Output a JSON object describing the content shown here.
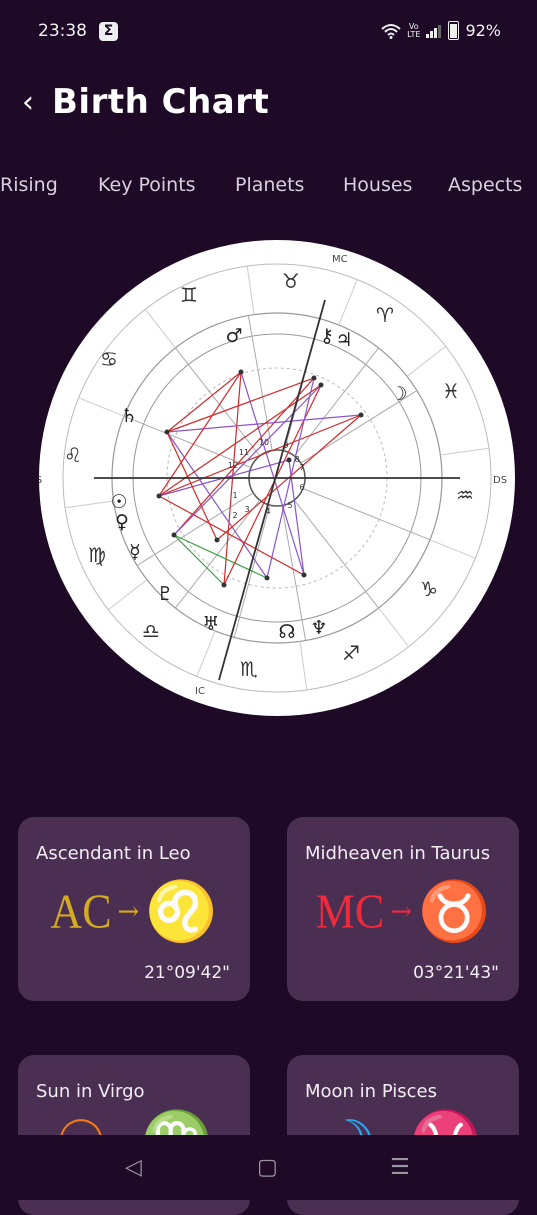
{
  "status_bar": {
    "time": "23:38",
    "app_icon": "Σ",
    "volte": "Vo\nLTE",
    "battery": "92%"
  },
  "header": {
    "back_icon": "‹",
    "title": "Birth Chart"
  },
  "tabs": [
    "Rising",
    "Key Points",
    "Planets",
    "Houses",
    "Aspects"
  ],
  "chart": {
    "labels": {
      "mc": "MC",
      "ic": "IC",
      "as": "AS",
      "ds": "DS"
    },
    "house_numbers": [
      "1",
      "2",
      "3",
      "4",
      "5",
      "6",
      "7",
      "8",
      "9",
      "10",
      "11",
      "12"
    ],
    "zodiac_glyphs": [
      "♉",
      "♈",
      "♓",
      "♒",
      "♑",
      "♐",
      "♏",
      "♎",
      "♍",
      "♌",
      "♋",
      "♊"
    ],
    "planet_glyphs": [
      "♂",
      "⚷",
      "♃",
      "☽",
      "♄",
      "☉",
      "♀",
      "☿",
      "♇",
      "♅",
      "☊",
      "♆"
    ]
  },
  "cards": [
    {
      "title": "Ascendant in Leo",
      "abbr": "AC",
      "arrow": "→",
      "sign": "♌",
      "value": "21°09'42\"",
      "color": "#d4aa22"
    },
    {
      "title": "Midheaven in Taurus",
      "abbr": "MC",
      "arrow": "→",
      "sign": "♉",
      "value": "03°21'43\"",
      "color": "#ee2a3c"
    },
    {
      "title": "Sun in Virgo",
      "sym1": "☉",
      "sign": "♍",
      "color": "#f07a18"
    },
    {
      "title": "Moon in Pisces",
      "sym1": "☽",
      "sign": "♓",
      "color": "#2aa6f0"
    }
  ],
  "navbar": {
    "back": "◁",
    "home": "▢",
    "recents": "☰"
  }
}
